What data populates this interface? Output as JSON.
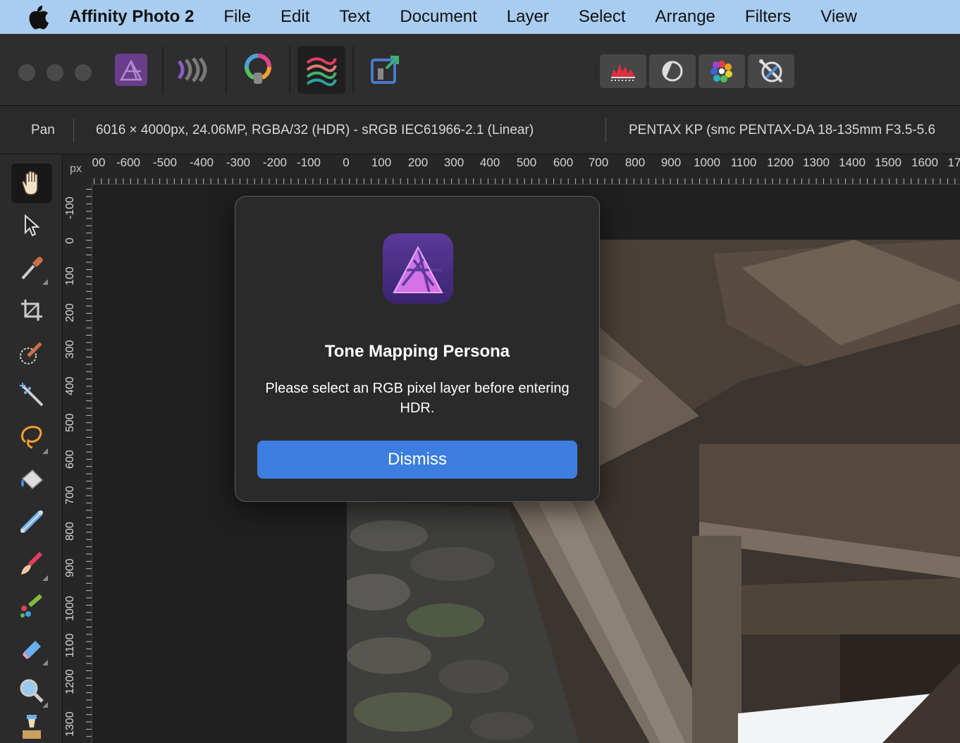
{
  "menubar": {
    "apple_icon": "apple-logo",
    "app_name": "Affinity Photo 2",
    "items": [
      "File",
      "Edit",
      "Text",
      "Document",
      "Layer",
      "Select",
      "Arrange",
      "Filters",
      "View"
    ]
  },
  "toolbar": {
    "personas": [
      "photo-persona-icon",
      "liquify-persona-icon",
      "develop-persona-icon",
      "tone-mapping-persona-icon",
      "export-persona-icon"
    ],
    "active_persona": "tone-mapping-persona-icon",
    "studio_buttons": [
      "histogram-icon",
      "adjustment-icon",
      "color-wheel-icon",
      "navigator-icon"
    ]
  },
  "context": {
    "tool_name": "Pan",
    "document_info": "6016 × 4000px, 24.06MP, RGBA/32 (HDR) - sRGB IEC61966-2.1 (Linear)",
    "camera_info": "PENTAX KP (smc PENTAX-DA 18-135mm F3.5-5.6"
  },
  "tools": [
    "hand-icon",
    "move-icon",
    "color-picker-icon",
    "crop-icon",
    "selection-brush-icon",
    "flood-select-icon",
    "freehand-select-icon",
    "fill-icon",
    "gradient-icon",
    "paint-brush-icon",
    "color-replacement-icon",
    "erase-brush-icon",
    "zoom-icon",
    "clone-icon"
  ],
  "rulers": {
    "unit": "px",
    "h_labels": [
      "00",
      "-600",
      "-500",
      "-400",
      "-300",
      "-200",
      "-100",
      "0",
      "100",
      "200",
      "300",
      "400",
      "500",
      "600",
      "700",
      "800",
      "900",
      "1000",
      "1100",
      "1200",
      "1300",
      "1400",
      "1500",
      "1600",
      "17"
    ],
    "v_labels": [
      "-100",
      "0",
      "100",
      "200",
      "300",
      "400",
      "500",
      "600",
      "700",
      "800",
      "900",
      "1000",
      "1100",
      "1200",
      "1300"
    ]
  },
  "dialog": {
    "icon": "affinity-photo-app-icon",
    "title": "Tone Mapping Persona",
    "message": "Please select an RGB pixel layer before entering HDR.",
    "dismiss_label": "Dismiss"
  },
  "colors": {
    "menubar": "#a9cdf0",
    "accent_button": "#3b7ee0",
    "affinity_purple": "#9b4de0"
  }
}
